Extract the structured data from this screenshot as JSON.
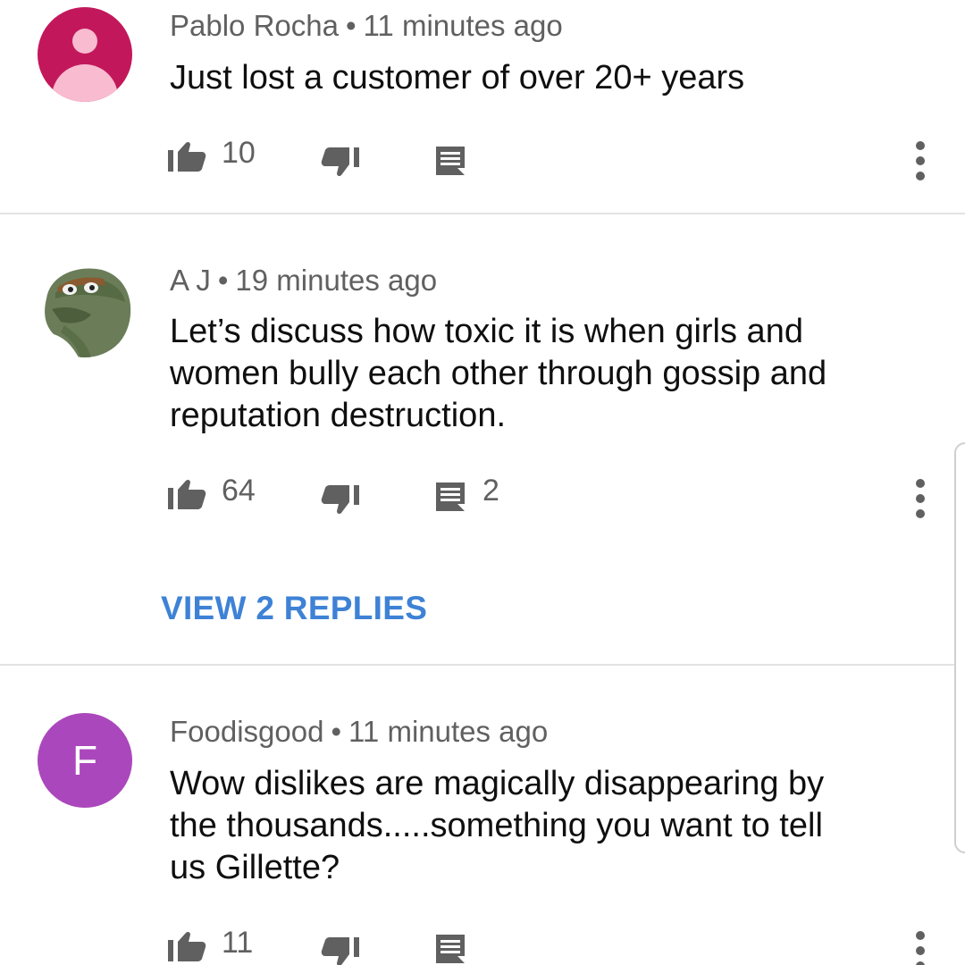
{
  "comments": [
    {
      "author": "Pablo Rocha",
      "separator": "•",
      "time": "11 minutes ago",
      "text": "Just lost a customer of over 20+ years",
      "likes": "10",
      "replies": "",
      "avatar": "person-icon"
    },
    {
      "author": "A J",
      "separator": "•",
      "time": "19 minutes ago",
      "text": "Let’s discuss how toxic it is when girls and women bully each other through gossip and reputation destruction.",
      "likes": "64",
      "replies": "2",
      "avatar": "oscar-photo",
      "view_replies": "VIEW 2 REPLIES"
    },
    {
      "author": "Foodisgood",
      "separator": "•",
      "time": "11 minutes ago",
      "text": "Wow dislikes are magically disappearing by the thousands.....something you want to tell us Gillette?",
      "likes": "11",
      "replies": "",
      "avatar": "F"
    }
  ],
  "icons": {
    "like": "thumbs-up-icon",
    "dislike": "thumbs-down-icon",
    "reply": "comment-icon",
    "more": "more-vertical-icon"
  },
  "colors": {
    "link": "#3e82d6",
    "meta": "#606060",
    "avatar_pink": "#c2185b",
    "avatar_purple": "#ab47bc"
  }
}
